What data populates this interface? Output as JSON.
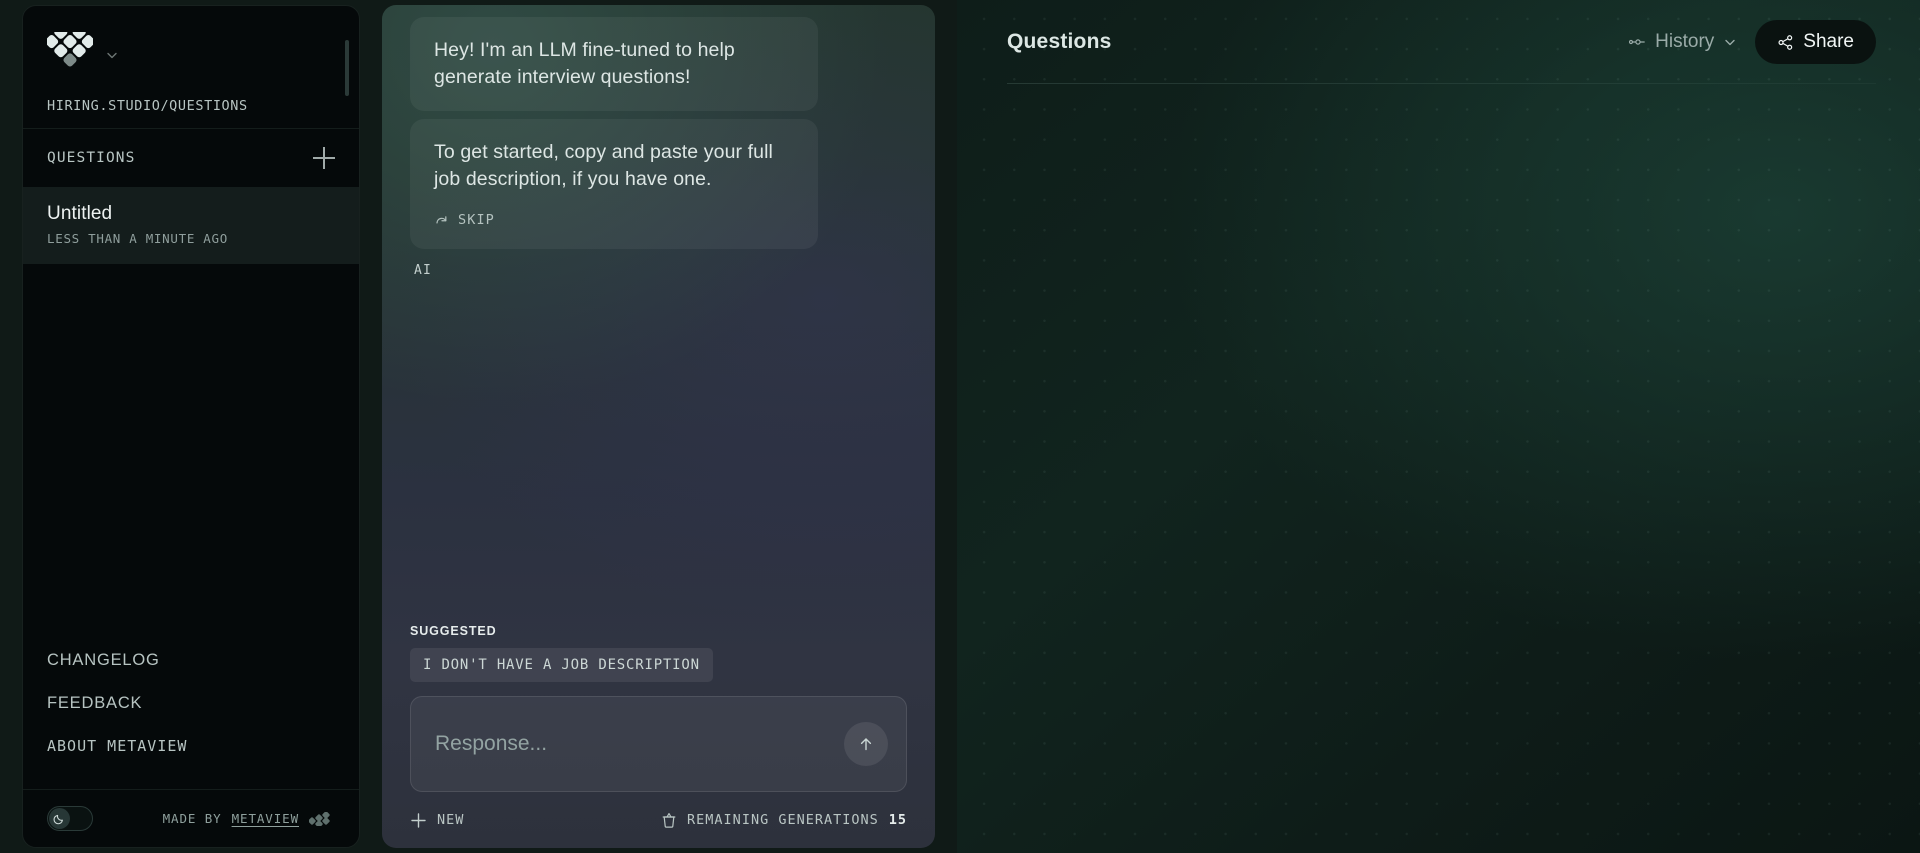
{
  "sidebar": {
    "brand": {
      "logo": "metaview-diamond-logo",
      "chevron": "chevron-down-icon"
    },
    "url": "HIRING.STUDIO/QUESTIONS",
    "section": {
      "title": "QUESTIONS",
      "add_icon": "plus-icon"
    },
    "conversations": [
      {
        "title": "Untitled",
        "time": "LESS THAN A MINUTE AGO",
        "selected": true
      }
    ],
    "links": [
      {
        "label": "CHANGELOG",
        "style": "sans"
      },
      {
        "label": "FEEDBACK",
        "style": "sans"
      },
      {
        "label": "ABOUT METAVIEW",
        "style": "mono"
      }
    ],
    "footer": {
      "theme_toggle_icon": "moon-icon",
      "made_by_prefix": "MADE BY ",
      "made_by_brand": "METAVIEW",
      "logo": "metaview-mini-logo"
    }
  },
  "chat": {
    "messages": [
      {
        "text": "Hey! I'm an LLM fine-tuned to help generate interview questions!",
        "has_action": false
      },
      {
        "text": "To get started, copy and paste your full job description, if you have one.",
        "has_action": true,
        "action_label": "SKIP",
        "action_icon": "skip-forward-icon"
      }
    ],
    "author_tag": "AI",
    "suggested": {
      "label": "SUGGESTED",
      "chips": [
        "I DON'T HAVE A JOB DESCRIPTION"
      ]
    },
    "composer": {
      "placeholder": "Response...",
      "value": "",
      "send_icon": "arrow-up-icon"
    },
    "footer": {
      "new_icon": "plus-icon",
      "new_label": "NEW",
      "generations_icon": "cup-icon",
      "generations_label": "REMAINING GENERATIONS",
      "generations_count": "15"
    }
  },
  "right": {
    "title": "Questions",
    "history": {
      "label": "History",
      "icon": "timeline-icon",
      "chevron": "chevron-down-icon"
    },
    "share": {
      "label": "Share",
      "icon": "share-icon"
    }
  },
  "colors": {
    "sidebar_bg": "#05090a",
    "selected_item_bg": "#141d1c",
    "chat_green": "#24362f",
    "chat_purple": "#303442",
    "right_green": "#11241e",
    "share_bg": "#0a1210",
    "text_primary": "#eef3f2",
    "text_muted": "#8f9e9c"
  }
}
